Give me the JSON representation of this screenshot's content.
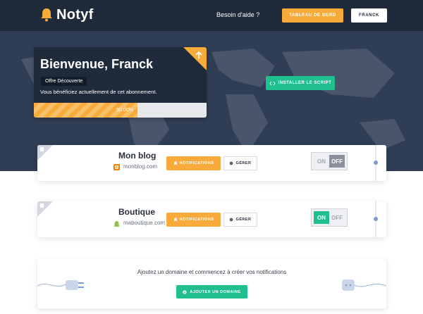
{
  "header": {
    "logo_text": "Notyf",
    "help_label": "Besoin d'aide ?",
    "dashboard_label": "TABLEAU DE BORD",
    "user_label": "FRANCK"
  },
  "welcome": {
    "title": "Bienvenue, Franck",
    "offer_badge": "Offre Découverte",
    "offer_text": "Vous bénéficiez actuellement de cet abonnement.",
    "progress_value": 0.6,
    "progress_label": "60.00%"
  },
  "install_label": "INSTALLER LE SCRIPT",
  "sites": [
    {
      "name": "Mon blog",
      "domain": "monblog.com",
      "platform_icon": "blogger-icon",
      "notifications_label": "NOTIFICATIONS",
      "manage_label": "GÉRER",
      "toggle_on_label": "ON",
      "toggle_off_label": "OFF",
      "enabled": false
    },
    {
      "name": "Boutique",
      "domain": "maboutique.com",
      "platform_icon": "shopify-icon",
      "notifications_label": "NOTIFICATIONS",
      "manage_label": "GÉRER",
      "toggle_on_label": "ON",
      "toggle_off_label": "OFF",
      "enabled": true
    }
  ],
  "add_domain": {
    "text": "Ajoutez un domaine et commencez à créer vos notifications",
    "button_label": "AJOUTER UN DOMAINE"
  },
  "colors": {
    "navy": "#1f2a3b",
    "hero": "#2f3d55",
    "orange": "#f7ab3b",
    "green": "#1fbf8f",
    "toggle_off_grey": "#8a919c"
  }
}
